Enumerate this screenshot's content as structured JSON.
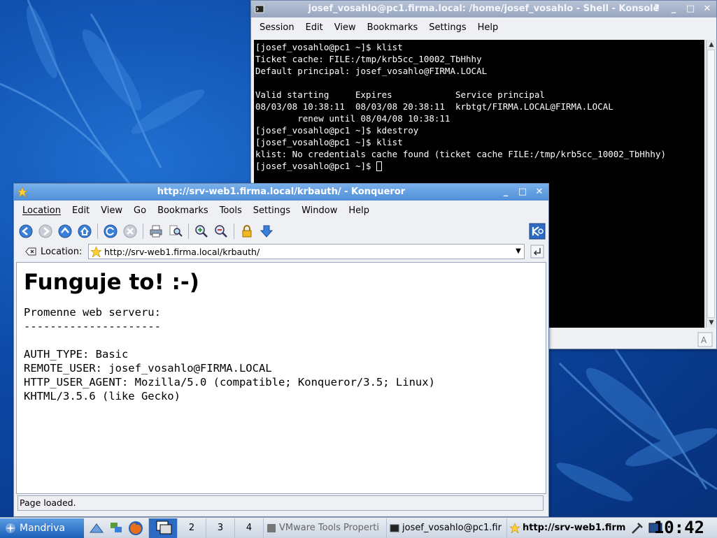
{
  "konsole": {
    "title": "josef_vosahlo@pc1.firma.local: /home/josef_vosahlo - Shell - Konsole",
    "menu": [
      "Session",
      "Edit",
      "View",
      "Bookmarks",
      "Settings",
      "Help"
    ],
    "terminal_lines": [
      "[josef_vosahlo@pc1 ~]$ klist",
      "Ticket cache: FILE:/tmp/krb5cc_10002_TbHhhy",
      "Default principal: josef_vosahlo@FIRMA.LOCAL",
      "",
      "Valid starting     Expires            Service principal",
      "08/03/08 10:38:11  08/03/08 20:38:11  krbtgt/FIRMA.LOCAL@FIRMA.LOCAL",
      "        renew until 08/04/08 10:38:11",
      "[josef_vosahlo@pc1 ~]$ kdestroy",
      "[josef_vosahlo@pc1 ~]$ klist",
      "klist: No credentials cache found (ticket cache FILE:/tmp/krb5cc_10002_TbHhhy)",
      "[josef_vosahlo@pc1 ~]$ "
    ]
  },
  "konqueror": {
    "title": "http://srv-web1.firma.local/krbauth/ - Konqueror",
    "menu": [
      "Location",
      "Edit",
      "View",
      "Go",
      "Bookmarks",
      "Tools",
      "Settings",
      "Window",
      "Help"
    ],
    "location_label": "Location:",
    "location_url": "http://srv-web1.firma.local/krbauth/",
    "page_heading": "Funguje to! :-)",
    "page_body": "Promenne web serveru:\n---------------------\n\nAUTH_TYPE: Basic\nREMOTE_USER: josef_vosahlo@FIRMA.LOCAL\nHTTP_USER_AGENT: Mozilla/5.0 (compatible; Konqueror/3.5; Linux)\nKHTML/3.5.6 (like Gecko)",
    "status": "Page loaded."
  },
  "taskbar": {
    "start_label": "Mandriva",
    "desktops": [
      "2",
      "3",
      "4"
    ],
    "tasks": [
      "VMware Tools Properti",
      "josef_vosahlo@pc1.fir",
      "http://srv-web1.firm"
    ],
    "clock": "10:42"
  },
  "icons": {
    "konsole_title_icon": "terminal-icon",
    "konq_title_icon": "star-icon",
    "toolbar": [
      "back-icon",
      "forward-icon",
      "up-icon",
      "home-icon",
      "reload-icon",
      "stop-icon",
      "print-icon",
      "find-icon",
      "zoom-in-icon",
      "zoom-out-icon",
      "security-icon",
      "download-icon"
    ]
  },
  "colors": {
    "accent": "#2d6ac4",
    "desktop": "#0d4aa8"
  }
}
